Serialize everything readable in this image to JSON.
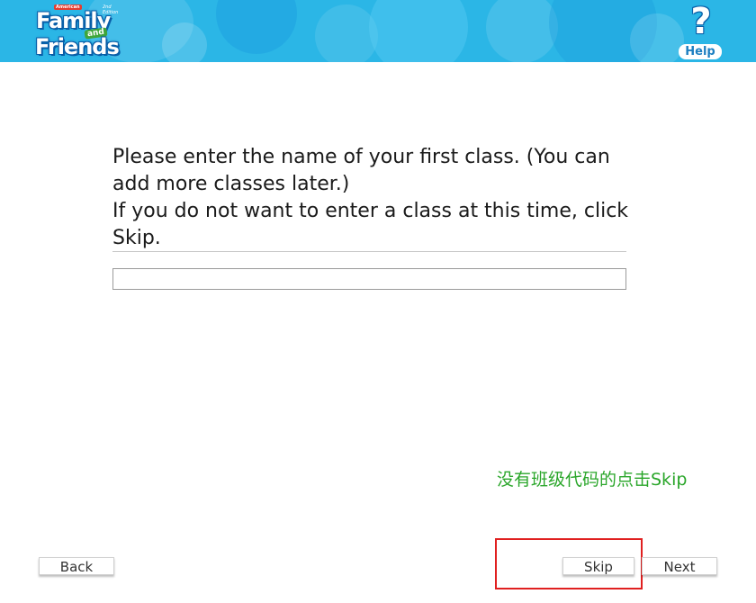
{
  "header": {
    "logo": {
      "brand_tag": "American",
      "edition": "2nd Edition",
      "word1": "Family",
      "word_and": "and",
      "word2": "Friends"
    },
    "help": {
      "icon": "question-mark-icon",
      "label": "Help"
    },
    "colors": {
      "background": "#2bb6e6"
    }
  },
  "prompt": {
    "line1": "Please enter the name of your first class. (You can add more classes later.)",
    "line2": "If you do not want to enter a class at this time, click Skip."
  },
  "class_name_input": {
    "value": "",
    "placeholder": ""
  },
  "annotation": {
    "hint": "没有班级代码的点击Skip",
    "hint_color": "#2aa62a",
    "highlight_color": "#e02020"
  },
  "buttons": {
    "back": "Back",
    "skip": "Skip",
    "next": "Next"
  }
}
